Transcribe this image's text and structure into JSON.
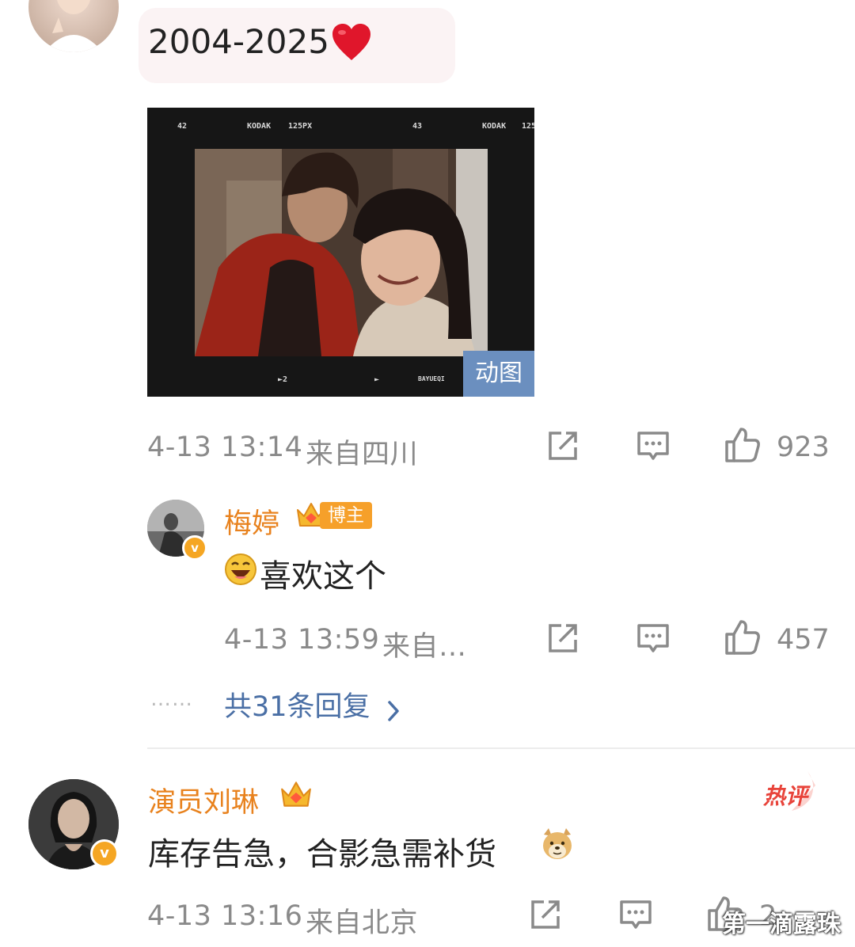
{
  "comment1": {
    "text": "2004-2025",
    "heart_emoji": "heart-emoji",
    "media": {
      "film_labels": [
        "42",
        "KODAK",
        "125PX",
        "43",
        "KODAK",
        "125"
      ],
      "bottom_labels": [
        "►2",
        "►",
        "BAYUEQI"
      ],
      "gif_badge": "动图"
    },
    "timestamp": "4-13 13:14",
    "location": "来自四川",
    "likes": "923"
  },
  "reply1": {
    "username": "梅婷",
    "tag": "博主",
    "text": "喜欢这个",
    "timestamp": "4-13 13:59",
    "location": "来自…",
    "likes": "457"
  },
  "more_replies": {
    "dots": "……",
    "label": "共31条回复"
  },
  "comment2": {
    "username": "演员刘琳",
    "hot_badge": "热评",
    "text": "库存告急，合影急需补货",
    "timestamp": "4-13 13:16",
    "location": "来自北京",
    "likes": "2,…"
  },
  "watermark": "第一滴露珠",
  "colors": {
    "username": "#e8821e",
    "link": "#4a6fa5",
    "meta": "#8a8a8a",
    "hot": "#e8433a",
    "gif_badge_bg": "#6b8fbf"
  }
}
